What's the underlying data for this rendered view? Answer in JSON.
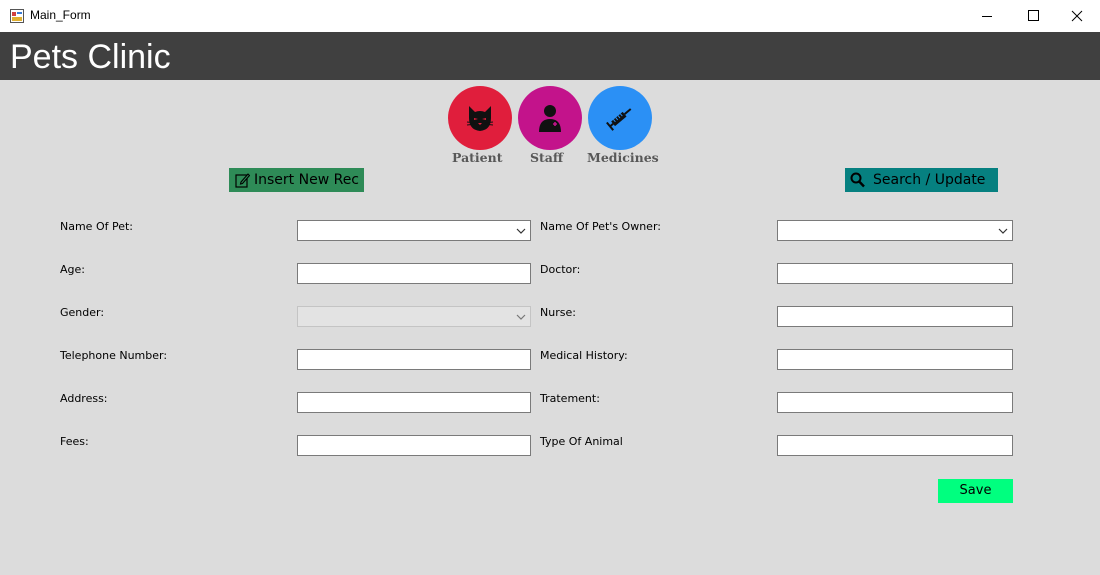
{
  "window": {
    "title": "Main_Form"
  },
  "header": {
    "title": "Pets Clinic"
  },
  "nav": {
    "patient": {
      "label": "Patient",
      "color": "#e01e3c",
      "icon": "cat-icon"
    },
    "staff": {
      "label": "Staff",
      "color": "#c3138b",
      "icon": "doctor-icon"
    },
    "medicines": {
      "label": "Medicines",
      "color": "#2b90f5",
      "icon": "syringe-icon"
    }
  },
  "actions": {
    "insert_label": "Insert New Rec",
    "insert_color": "#2e8b57",
    "search_label": "Search / Update",
    "search_color": "#068080",
    "save_label": "Save",
    "save_color": "#00ff7f"
  },
  "form": {
    "left": [
      {
        "label": "Name Of Pet:",
        "type": "select",
        "value": ""
      },
      {
        "label": "Age:",
        "type": "text",
        "value": ""
      },
      {
        "label": "Gender:",
        "type": "select",
        "value": "",
        "disabled": true
      },
      {
        "label": "Telephone Number:",
        "type": "text",
        "value": ""
      },
      {
        "label": "Address:",
        "type": "text",
        "value": ""
      },
      {
        "label": "Fees:",
        "type": "text",
        "value": ""
      }
    ],
    "right": [
      {
        "label": "Name Of Pet's Owner:",
        "type": "select",
        "value": ""
      },
      {
        "label": "Doctor:",
        "type": "text",
        "value": ""
      },
      {
        "label": "Nurse:",
        "type": "text",
        "value": ""
      },
      {
        "label": "Medical History:",
        "type": "text",
        "value": ""
      },
      {
        "label": "Tratement:",
        "type": "text",
        "value": ""
      },
      {
        "label": "Type Of Animal",
        "type": "text",
        "value": ""
      }
    ]
  }
}
